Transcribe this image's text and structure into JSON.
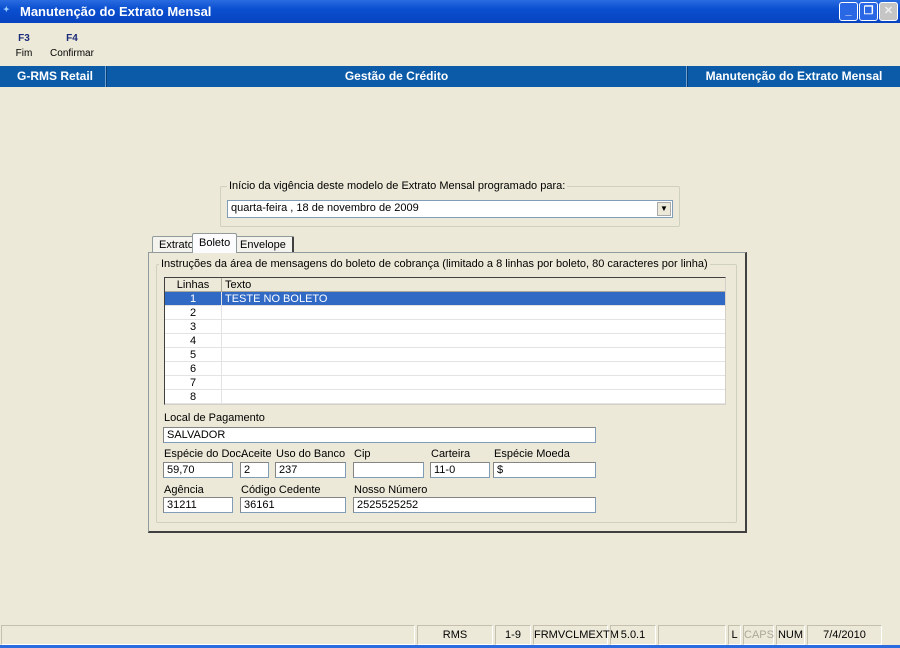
{
  "window": {
    "title": "Manutenção do Extrato Mensal",
    "minimize": "_",
    "restore": "❐",
    "close": "✕"
  },
  "toolbar": [
    {
      "key": "F3",
      "label": "Fim"
    },
    {
      "key": "F4",
      "label": "Confirmar"
    }
  ],
  "header": {
    "left": "G-RMS Retail",
    "center": "Gestão de Crédito",
    "right": "Manutenção do Extrato Mensal"
  },
  "vigencia": {
    "legend": "Início da vigência deste modelo de Extrato Mensal programado para:",
    "value": "quarta-feira  , 18 de novembro de 2009"
  },
  "tabs": [
    {
      "label": "Extrato"
    },
    {
      "label": "Boleto",
      "selected": true
    },
    {
      "label": "Envelope"
    }
  ],
  "instrucoes": {
    "legend": "Instruções da área de mensagens do boleto de cobrança (limitado a 8 linhas por boleto, 80 caracteres por linha)",
    "columns": [
      "Linhas",
      "Texto"
    ],
    "rows": [
      {
        "n": "1",
        "t": "TESTE NO BOLETO"
      },
      {
        "n": "2",
        "t": ""
      },
      {
        "n": "3",
        "t": ""
      },
      {
        "n": "4",
        "t": ""
      },
      {
        "n": "5",
        "t": ""
      },
      {
        "n": "6",
        "t": ""
      },
      {
        "n": "7",
        "t": ""
      },
      {
        "n": "8",
        "t": ""
      }
    ]
  },
  "fields": {
    "local": {
      "label": "Local de Pagamento",
      "value": "SALVADOR"
    },
    "especie_doc": {
      "label": "Espécie do Doc.",
      "value": "59,70"
    },
    "aceite": {
      "label": "Aceite",
      "value": "2"
    },
    "uso_banco": {
      "label": "Uso do Banco",
      "value": "237"
    },
    "cip": {
      "label": "Cip",
      "value": ""
    },
    "carteira": {
      "label": "Carteira",
      "value": "11-0"
    },
    "especie_moeda": {
      "label": "Espécie Moeda",
      "value": "$"
    },
    "agencia": {
      "label": "Agência",
      "value": "31211"
    },
    "codigo_cedente": {
      "label": "Código Cedente",
      "value": "36161"
    },
    "nosso_numero": {
      "label": "Nosso Número",
      "value": "2525525252"
    }
  },
  "status": {
    "app": "RMS",
    "range": "1-9",
    "form": "FRMVCLMEXTM",
    "version": "5.0.1",
    "l": "L",
    "caps": "CAPS",
    "num": "NUM",
    "date": "7/4/2010"
  },
  "colors": {
    "titlebar": "#0a4fd0",
    "header": "#0b5ba8",
    "selection": "#316ac5"
  }
}
